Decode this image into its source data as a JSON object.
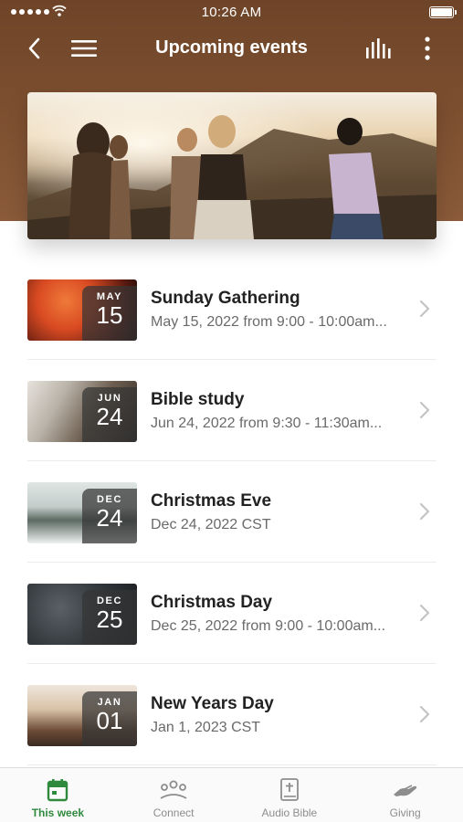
{
  "status_bar": {
    "time": "10:26 AM"
  },
  "nav": {
    "title": "Upcoming events",
    "back_icon": "chevron-left-icon",
    "menu_icon": "hamburger-menu-icon",
    "stats_icon": "bar-chart-icon",
    "more_icon": "more-vertical-icon"
  },
  "events": [
    {
      "month": "MAY",
      "day": "15",
      "title": "Sunday Gathering",
      "subtitle": "May 15, 2022 from 9:00 - 10:00am..."
    },
    {
      "month": "JUN",
      "day": "24",
      "title": "Bible study",
      "subtitle": "Jun 24, 2022 from 9:30 - 11:30am..."
    },
    {
      "month": "DEC",
      "day": "24",
      "title": "Christmas Eve",
      "subtitle": "Dec 24, 2022 CST"
    },
    {
      "month": "DEC",
      "day": "25",
      "title": "Christmas Day",
      "subtitle": "Dec 25, 2022 from 9:00 - 10:00am..."
    },
    {
      "month": "JAN",
      "day": "01",
      "title": "New Years Day",
      "subtitle": "Jan 1, 2023 CST"
    }
  ],
  "tabs": [
    {
      "label": "This week",
      "icon": "calendar-icon",
      "active": true
    },
    {
      "label": "Connect",
      "icon": "people-group-icon",
      "active": false
    },
    {
      "label": "Audio Bible",
      "icon": "bible-icon",
      "active": false
    },
    {
      "label": "Giving",
      "icon": "giving-hand-icon",
      "active": false
    }
  ],
  "colors": {
    "header": "#7b4e2f",
    "active_tab": "#2f8a3e"
  }
}
